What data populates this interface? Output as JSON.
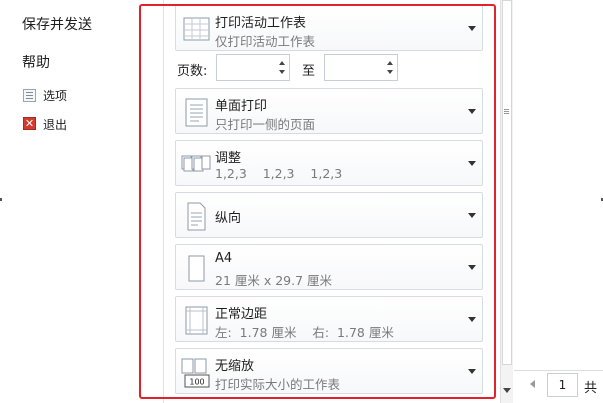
{
  "nav": {
    "save_send": "保存并发送",
    "help": "帮助",
    "options": "选项",
    "exit": "退出"
  },
  "settings": {
    "print_what": {
      "title": "打印活动工作表",
      "subtitle": "仅打印活动工作表"
    },
    "pages": {
      "label": "页数:",
      "to": "至",
      "from_value": "",
      "to_value": ""
    },
    "sides": {
      "title": "单面打印",
      "subtitle": "只打印一侧的页面"
    },
    "collate": {
      "title": "调整",
      "subtitle": "1,2,3    1,2,3    1,2,3"
    },
    "orientation": {
      "title": "纵向"
    },
    "paper": {
      "title": "A4",
      "subtitle": "21 厘米 x 29.7 厘米"
    },
    "margins": {
      "title": "正常边距",
      "subtitle": "左:  1.78 厘米    右:  1.78 厘米"
    },
    "scaling": {
      "title": "无缩放",
      "subtitle": "打印实际大小的工作表",
      "icon_text": "100"
    }
  },
  "preview": {
    "page_number": "1",
    "page_total_label": "共"
  },
  "colors": {
    "highlight": "#e0232b",
    "exit_icon": "#d53a2e"
  }
}
